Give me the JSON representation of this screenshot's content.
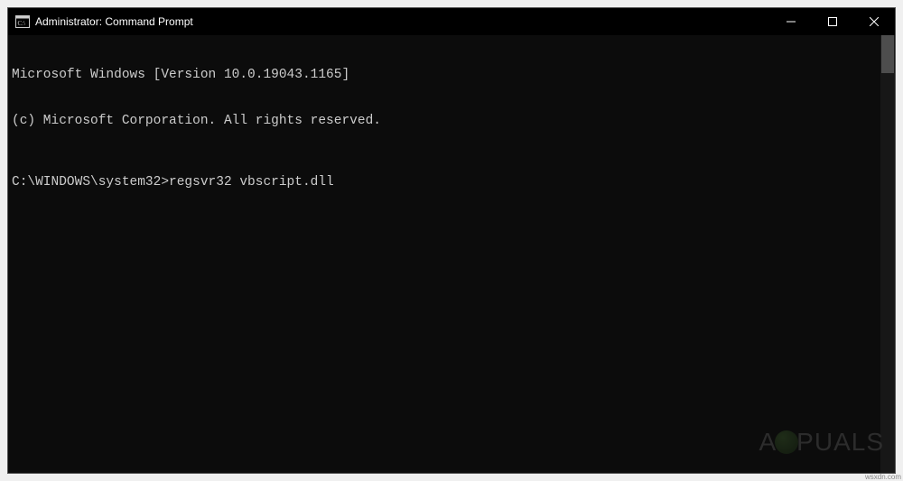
{
  "window": {
    "title": "Administrator: Command Prompt"
  },
  "terminal": {
    "line1": "Microsoft Windows [Version 10.0.19043.1165]",
    "line2": "(c) Microsoft Corporation. All rights reserved.",
    "prompt": "C:\\WINDOWS\\system32>",
    "command": "regsvr32 vbscript.dll"
  },
  "watermark": {
    "left": "A",
    "right": "PUALS"
  },
  "footer": {
    "src": "wsxdn.com"
  }
}
